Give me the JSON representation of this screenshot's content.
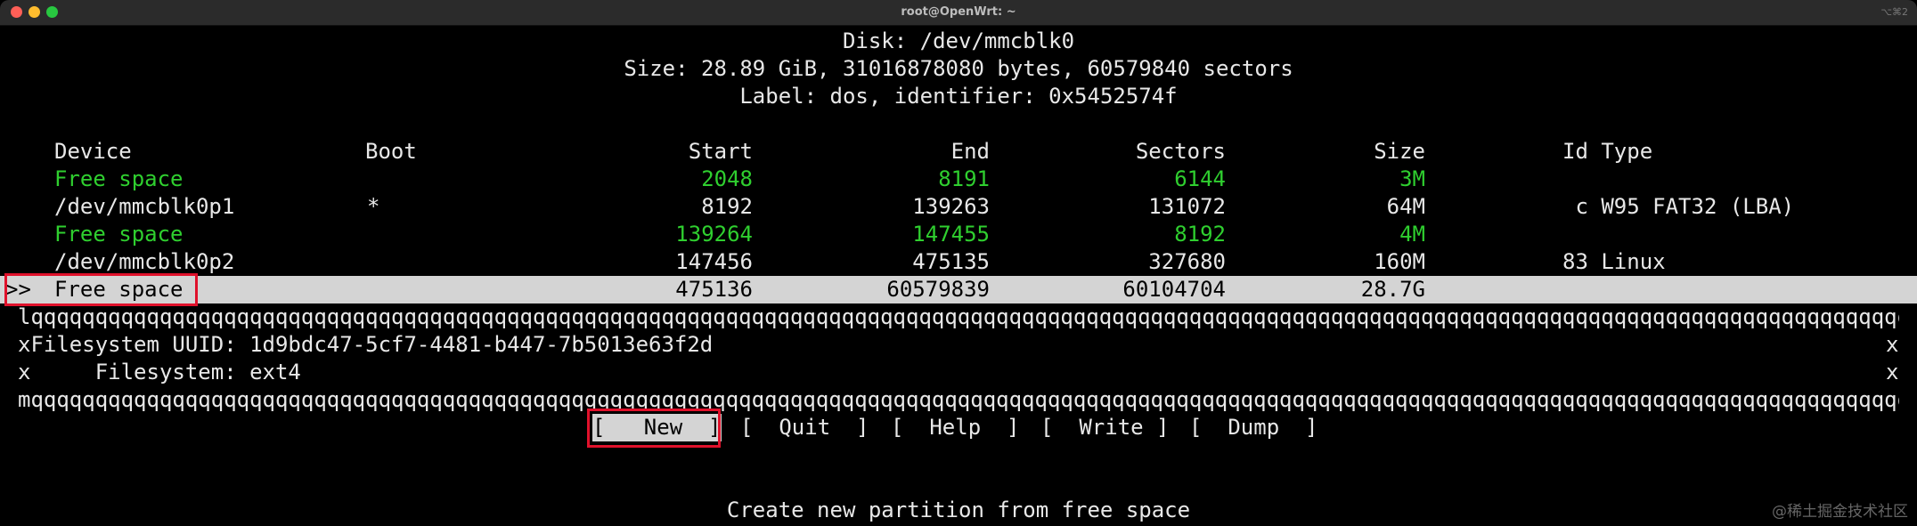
{
  "window": {
    "title": "root@OpenWrt: ~",
    "shortcut": "⌥⌘2"
  },
  "disk": {
    "line1": "Disk: /dev/mmcblk0",
    "line2": "Size: 28.89 GiB, 31016878080 bytes, 60579840 sectors",
    "line3": "Label: dos, identifier: 0x5452574f"
  },
  "table": {
    "headers": {
      "device": "Device",
      "boot": "Boot",
      "start": "Start",
      "end": "End",
      "sectors": "Sectors",
      "size": "Size",
      "idtype": "Id Type"
    },
    "rows": [
      {
        "device": "Free space",
        "boot": "",
        "start": "2048",
        "end": "8191",
        "sectors": "6144",
        "size": "3M",
        "idtype": ""
      },
      {
        "device": "/dev/mmcblk0p1",
        "boot": "*",
        "start": "8192",
        "end": "139263",
        "sectors": "131072",
        "size": "64M",
        "idtype": " c W95 FAT32 (LBA)"
      },
      {
        "device": "Free space",
        "boot": "",
        "start": "139264",
        "end": "147455",
        "sectors": "8192",
        "size": "4M",
        "idtype": ""
      },
      {
        "device": "/dev/mmcblk0p2",
        "boot": "",
        "start": "147456",
        "end": "475135",
        "sectors": "327680",
        "size": "160M",
        "idtype": "83 Linux"
      },
      {
        "device": "Free space",
        "boot": "",
        "start": "475136",
        "end": "60579839",
        "sectors": "60104704",
        "size": "28.7G",
        "idtype": "",
        "cursor": ">>"
      }
    ]
  },
  "info": {
    "top_border": "lqqqqqqqqqqqqqqqqqqqqqqqqqqqqqqqqqqqqqqqqqqqqqqqqqqqqqqqqqqqqqqqqqqqqqqqqqqqqqqqqqqqqqqqqqqqqqqqqqqqqqqqqqqqqqqqqqqqqqqqqqqqqqqqqqqqqqqqqqqqqqqqqqqqqqqqqqqqqqk",
    "line1": "xFilesystem UUID: 1d9bdc47-5cf7-4481-b447-7b5013e63f2d",
    "line2": "x     Filesystem: ext4",
    "right_edge": "x",
    "bottom_border": "mqqqqqqqqqqqqqqqqqqqqqqqqqqqqqqqqqqqqqqqqqqqqqqqqqqqqqqqqqqqqqqqqqqqqqqqqqqqqqqqqqqqqqqqqqqqqqqqqqqqqqqqqqqqqqqqqqqqqqqqqqqqqqqqqqqqqqqqqqqqqqqqqqqqqqqqqqqqqqj"
  },
  "menu": {
    "new": "[   New  ]",
    "quit": "[  Quit  ]",
    "help": "[  Help  ]",
    "write": "[  Write ]",
    "dump": "[  Dump  ]"
  },
  "status": "Create new partition from free space",
  "watermark": "@稀土掘金技术社区"
}
